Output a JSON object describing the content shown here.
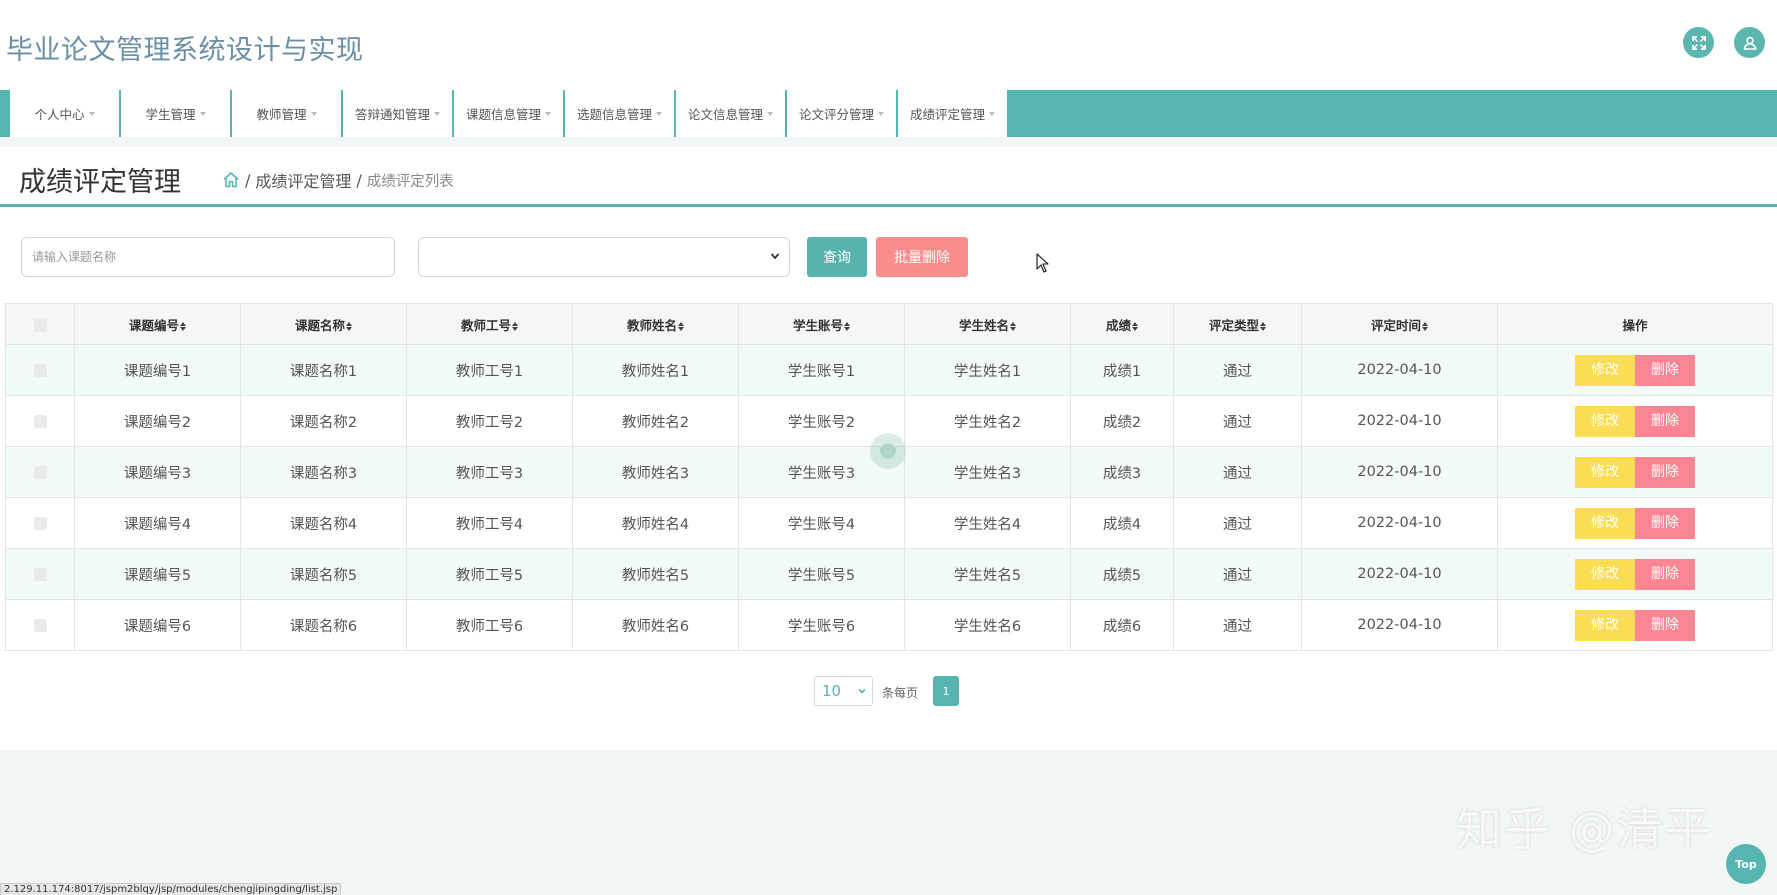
{
  "header": {
    "title": "毕业论文管理系统设计与实现",
    "fullscreen_icon": "expand-icon",
    "user_icon": "user-icon"
  },
  "nav": {
    "items": [
      {
        "label": "个人中心"
      },
      {
        "label": "学生管理"
      },
      {
        "label": "教师管理"
      },
      {
        "label": "答辩通知管理"
      },
      {
        "label": "课题信息管理"
      },
      {
        "label": "选题信息管理"
      },
      {
        "label": "论文信息管理"
      },
      {
        "label": "论文评分管理"
      },
      {
        "label": "成绩评定管理"
      }
    ]
  },
  "page": {
    "title": "成绩评定管理",
    "breadcrumb": {
      "home_icon": "home-icon",
      "level1": "成绩评定管理",
      "level2": "成绩评定列表"
    }
  },
  "search": {
    "placeholder": "请输入课题名称",
    "value": "",
    "select_value": "",
    "query_label": "查询",
    "bulk_delete_label": "批量删除"
  },
  "table": {
    "headers": [
      "课题编号",
      "课题名称",
      "教师工号",
      "教师姓名",
      "学生账号",
      "学生姓名",
      "成绩",
      "评定类型",
      "评定时间",
      "操作"
    ],
    "rows": [
      [
        "课题编号1",
        "课题名称1",
        "教师工号1",
        "教师姓名1",
        "学生账号1",
        "学生姓名1",
        "成绩1",
        "通过",
        "2022-04-10"
      ],
      [
        "课题编号2",
        "课题名称2",
        "教师工号2",
        "教师姓名2",
        "学生账号2",
        "学生姓名2",
        "成绩2",
        "通过",
        "2022-04-10"
      ],
      [
        "课题编号3",
        "课题名称3",
        "教师工号3",
        "教师姓名3",
        "学生账号3",
        "学生姓名3",
        "成绩3",
        "通过",
        "2022-04-10"
      ],
      [
        "课题编号4",
        "课题名称4",
        "教师工号4",
        "教师姓名4",
        "学生账号4",
        "学生姓名4",
        "成绩4",
        "通过",
        "2022-04-10"
      ],
      [
        "课题编号5",
        "课题名称5",
        "教师工号5",
        "教师姓名5",
        "学生账号5",
        "学生姓名5",
        "成绩5",
        "通过",
        "2022-04-10"
      ],
      [
        "课题编号6",
        "课题名称6",
        "教师工号6",
        "教师姓名6",
        "学生账号6",
        "学生姓名6",
        "成绩6",
        "通过",
        "2022-04-10"
      ]
    ],
    "edit_label": "修改",
    "delete_label": "删除"
  },
  "pagination": {
    "page_size": "10",
    "per_page_label": "条每页",
    "current_page": "1"
  },
  "watermark": "知乎 @清平",
  "top_button_label": "Top",
  "status_url": "2.129.11.174:8017/jspm2blqy/jsp/modules/chengjipingding/list.jsp",
  "colors": {
    "accent": "#56b5b0",
    "edit_button": "#fbdc55",
    "delete_button": "#fb8592",
    "bulk_delete_button": "#f98d8b",
    "title_text": "#6a8fa6"
  }
}
